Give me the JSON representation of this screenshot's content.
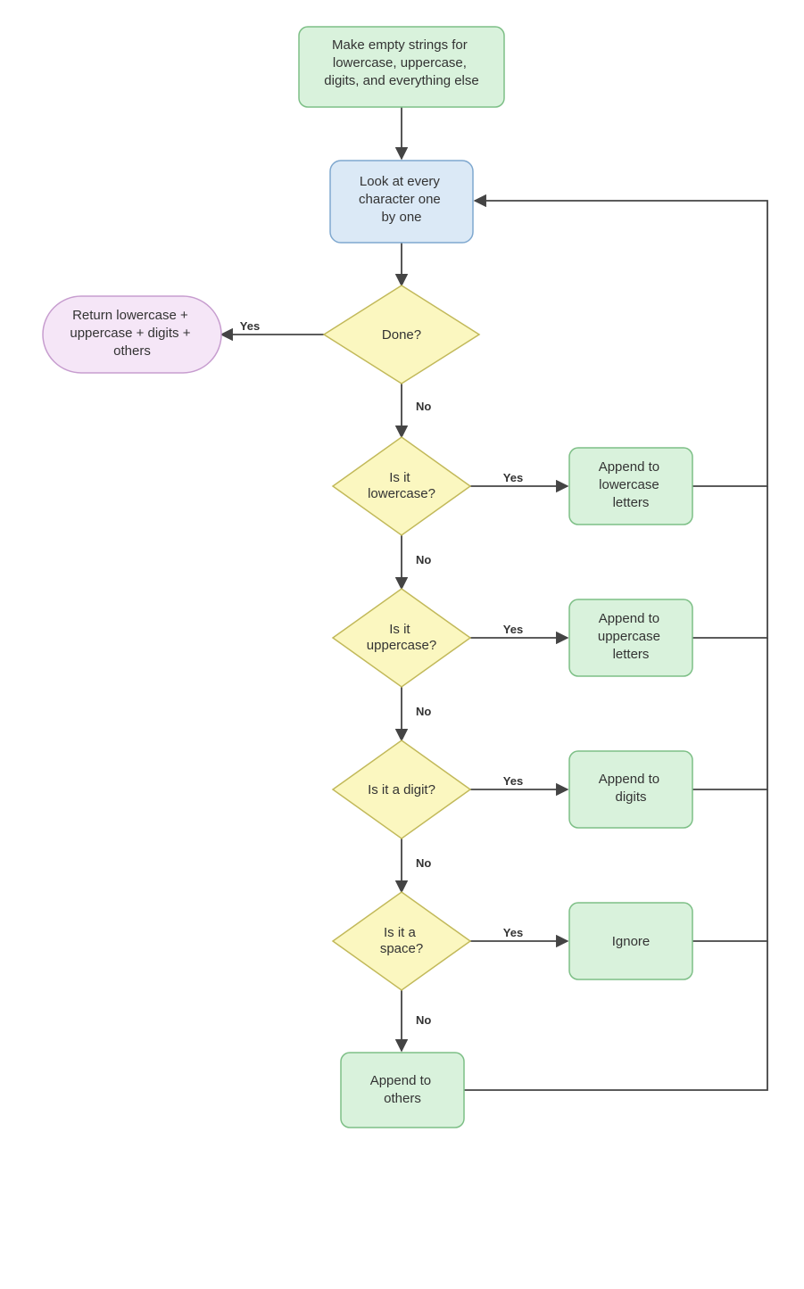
{
  "flow": {
    "start": "Make empty strings for\nlowercase, uppercase,\ndigits, and everything else",
    "loop": "Look at every\ncharacter one\nby one",
    "done": "Done?",
    "return": "Return lowercase +\nuppercase + digits +\nothers",
    "is_lower": "Is it\nlowercase?",
    "append_lower": "Append to\nlowercase\nletters",
    "is_upper": "Is it\nuppercase?",
    "append_upper": "Append to\nuppercase\nletters",
    "is_digit": "Is it a digit?",
    "append_digit": "Append to\ndigits",
    "is_space": "Is it a\nspace?",
    "ignore": "Ignore",
    "append_other": "Append to\nothers"
  },
  "labels": {
    "yes": "Yes",
    "no": "No"
  },
  "chart_data": {
    "type": "flowchart",
    "nodes": [
      {
        "id": "start",
        "shape": "process",
        "text": "Make empty strings for lowercase, uppercase, digits, and everything else"
      },
      {
        "id": "loop",
        "shape": "process",
        "text": "Look at every character one by one"
      },
      {
        "id": "done",
        "shape": "decision",
        "text": "Done?"
      },
      {
        "id": "return",
        "shape": "terminator",
        "text": "Return lowercase + uppercase + digits + others"
      },
      {
        "id": "is_lower",
        "shape": "decision",
        "text": "Is it lowercase?"
      },
      {
        "id": "append_lower",
        "shape": "process",
        "text": "Append to lowercase letters"
      },
      {
        "id": "is_upper",
        "shape": "decision",
        "text": "Is it uppercase?"
      },
      {
        "id": "append_upper",
        "shape": "process",
        "text": "Append to uppercase letters"
      },
      {
        "id": "is_digit",
        "shape": "decision",
        "text": "Is it a digit?"
      },
      {
        "id": "append_digit",
        "shape": "process",
        "text": "Append to digits"
      },
      {
        "id": "is_space",
        "shape": "decision",
        "text": "Is it a space?"
      },
      {
        "id": "ignore",
        "shape": "process",
        "text": "Ignore"
      },
      {
        "id": "append_other",
        "shape": "process",
        "text": "Append to others"
      }
    ],
    "edges": [
      {
        "from": "start",
        "to": "loop",
        "label": ""
      },
      {
        "from": "loop",
        "to": "done",
        "label": ""
      },
      {
        "from": "done",
        "to": "return",
        "label": "Yes"
      },
      {
        "from": "done",
        "to": "is_lower",
        "label": "No"
      },
      {
        "from": "is_lower",
        "to": "append_lower",
        "label": "Yes"
      },
      {
        "from": "is_lower",
        "to": "is_upper",
        "label": "No"
      },
      {
        "from": "is_upper",
        "to": "append_upper",
        "label": "Yes"
      },
      {
        "from": "is_upper",
        "to": "is_digit",
        "label": "No"
      },
      {
        "from": "is_digit",
        "to": "append_digit",
        "label": "Yes"
      },
      {
        "from": "is_digit",
        "to": "is_space",
        "label": "No"
      },
      {
        "from": "is_space",
        "to": "ignore",
        "label": "Yes"
      },
      {
        "from": "is_space",
        "to": "append_other",
        "label": "No"
      },
      {
        "from": "append_lower",
        "to": "loop",
        "label": ""
      },
      {
        "from": "append_upper",
        "to": "loop",
        "label": ""
      },
      {
        "from": "append_digit",
        "to": "loop",
        "label": ""
      },
      {
        "from": "ignore",
        "to": "loop",
        "label": ""
      },
      {
        "from": "append_other",
        "to": "loop",
        "label": ""
      }
    ]
  }
}
